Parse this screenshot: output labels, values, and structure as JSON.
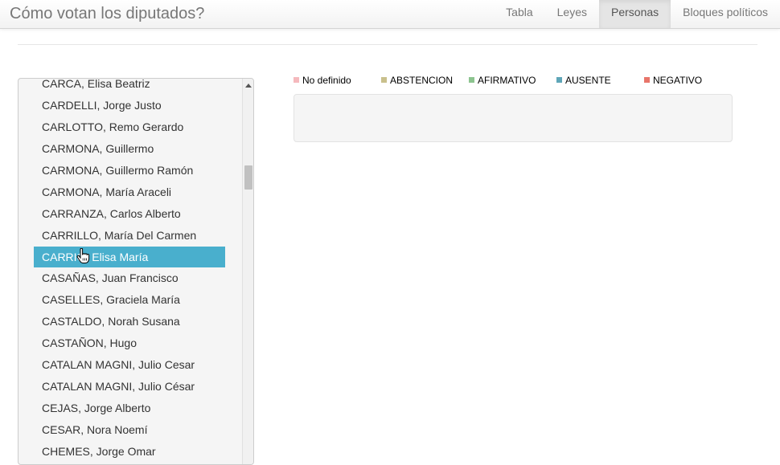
{
  "header": {
    "title": "Cómo votan los diputados?",
    "tabs": [
      {
        "label": "Tabla",
        "active": false
      },
      {
        "label": "Leyes",
        "active": false
      },
      {
        "label": "Personas",
        "active": true
      },
      {
        "label": "Bloques políticos",
        "active": false
      }
    ]
  },
  "deputies": {
    "items": [
      "CARCA, Elisa Beatriz",
      "CARDELLI, Jorge Justo",
      "CARLOTTO, Remo Gerardo",
      "CARMONA, Guillermo",
      "CARMONA, Guillermo Ramón",
      "CARMONA, María Araceli",
      "CARRANZA, Carlos Alberto",
      "CARRILLO, María Del Carmen",
      "CARRIÓ, Elisa María",
      "CASAÑAS, Juan Francisco",
      "CASELLES, Graciela María",
      "CASTALDO, Norah Susana",
      "CASTAÑON, Hugo",
      "CATALAN MAGNI, Julio Cesar",
      "CATALAN MAGNI, Julio César",
      "CEJAS, Jorge Alberto",
      "CESAR, Nora Noemí",
      "CHEMES, Jorge Omar"
    ],
    "selected": "CARRIÓ, Elisa María"
  },
  "legend": {
    "items": [
      {
        "label": "No definido",
        "color": "#f5b9bd"
      },
      {
        "label": "ABSTENCION",
        "color": "#c9c08c"
      },
      {
        "label": "AFIRMATIVO",
        "color": "#8cc48f"
      },
      {
        "label": "AUSENTE",
        "color": "#5fa6b8"
      },
      {
        "label": "NEGATIVO",
        "color": "#e8756a"
      }
    ]
  },
  "icons": {
    "cursor": "hand-pointer-icon",
    "scroll_up": "scroll-up-arrow-icon"
  }
}
